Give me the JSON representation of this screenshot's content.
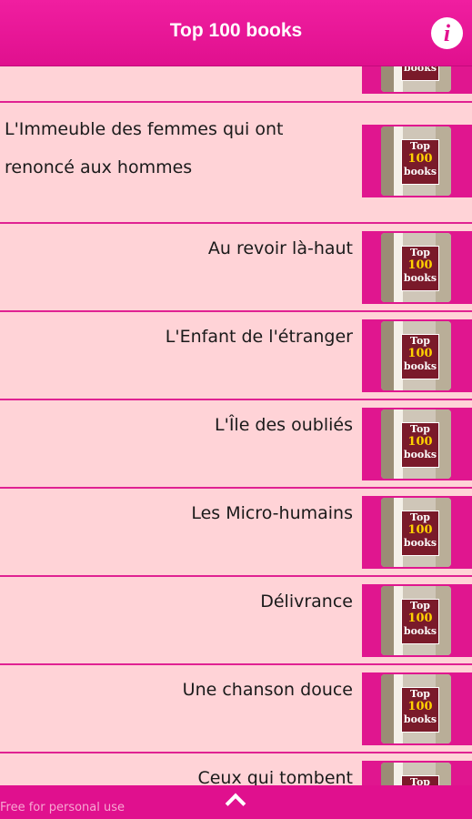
{
  "header": {
    "title": "Top 100 books",
    "info_icon": "i"
  },
  "book_cover": {
    "line1": "Top",
    "line2": "100",
    "line3": "books"
  },
  "books": [
    {
      "title": ""
    },
    {
      "title": "L'Immeuble des femmes qui ont renoncé aux hommes"
    },
    {
      "title": "Au revoir là-haut"
    },
    {
      "title": "L'Enfant de l'étranger"
    },
    {
      "title": "L'Île des oubliés"
    },
    {
      "title": "Les Micro-humains"
    },
    {
      "title": "Délivrance"
    },
    {
      "title": "Une chanson douce"
    },
    {
      "title": "Ceux qui tombent"
    }
  ],
  "footer": {
    "watermark": "Free for personal use"
  },
  "colors": {
    "accent": "#e0108e",
    "row_background": "#ffd3d7",
    "divider": "#e02292"
  }
}
